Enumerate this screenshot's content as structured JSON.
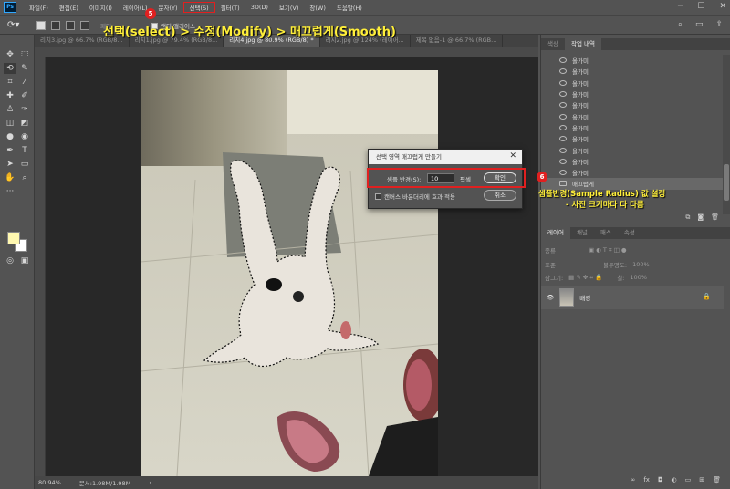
{
  "menubar": {
    "logo": "Ps",
    "items": [
      "파일(F)",
      "편집(E)",
      "이미지(I)",
      "레이어(L)",
      "문자(Y)",
      "선택(S)",
      "필터(T)",
      "3D(D)",
      "보기(V)",
      "창(W)",
      "도움말(H)"
    ]
  },
  "options": {
    "feather_label": "페더:",
    "antialias_label": "앤티 앨리어스"
  },
  "annotations": {
    "title": "선택(select) > 수정(Modify) > 매끄럽게(Smooth)",
    "step5": "5",
    "step6": "6",
    "side_line1": "샘플반경(Sample Radius) 값 설정",
    "side_line2": "- 사진 크기마다 다 다름"
  },
  "tabs": [
    {
      "label": "리치3.jpg @ 66.7% (RGB/8...",
      "active": false
    },
    {
      "label": "리치1.jpg @ 79.4% (RGB/8...",
      "active": false
    },
    {
      "label": "리치4.jpg @ 80.9% (RGB/8) *",
      "active": true
    },
    {
      "label": "리치2.jpg @ 124% (레이어...",
      "active": false
    },
    {
      "label": "제목 없음-1 @ 66.7% (RGB...",
      "active": false
    }
  ],
  "status": {
    "zoom": "80.94%",
    "doc": "문서:1.98M/1.98M"
  },
  "dialog": {
    "title": "선택 영역 매끄럽게 만들기",
    "label": "샘플 반경(S):",
    "value": "10",
    "unit": "픽셀",
    "ok": "확인",
    "cancel": "취소",
    "checkbox_label": "캔버스 바운더리에 효과 적용"
  },
  "history": {
    "tabs": [
      "색상",
      "작업 내역"
    ],
    "rows": [
      "올가미",
      "올가미",
      "올가미",
      "올가미",
      "올가미",
      "올가미",
      "올가미",
      "올가미",
      "올가미",
      "올가미",
      "올가미",
      "매끄럽게"
    ],
    "current_index": 11
  },
  "layers": {
    "tabs": [
      "레이어",
      "채널",
      "패스",
      "속성"
    ],
    "kind_label": "종류",
    "blend_label": "표준",
    "opacity_label": "불투명도:",
    "opacity_value": "100%",
    "lock_label": "잠그기:",
    "fill_label": "칠:",
    "fill_value": "100%",
    "layer_name": "배경"
  }
}
